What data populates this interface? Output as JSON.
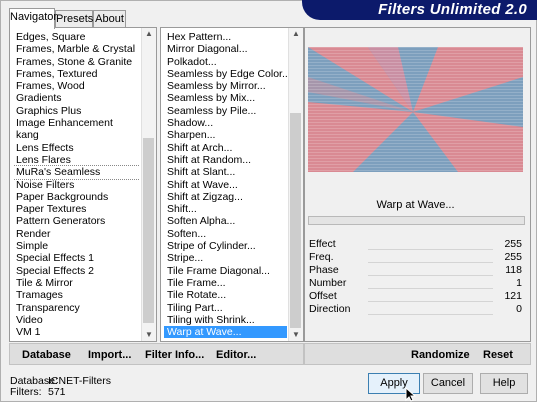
{
  "window": {
    "title": "Filters Unlimited 2.0"
  },
  "tabs": [
    {
      "label": "Navigator"
    },
    {
      "label": "Presets"
    },
    {
      "label": "About"
    }
  ],
  "categories": {
    "items": [
      "Edges, Square",
      "Frames, Marble & Crystal",
      "Frames, Stone & Granite",
      "Frames, Textured",
      "Frames, Wood",
      "Gradients",
      "Graphics Plus",
      "Image Enhancement",
      "kang",
      "Lens Effects",
      "Lens Flares",
      "MuRa's Seamless",
      "Noise Filters",
      "Paper Backgrounds",
      "Paper Textures",
      "Pattern Generators",
      "Render",
      "Simple",
      "Special Effects 1",
      "Special Effects 2",
      "Tile & Mirror",
      "Tramages",
      "Transparency",
      "Video",
      "VM 1"
    ],
    "selected": "MuRa's Seamless"
  },
  "filters": {
    "items": [
      "Hex Pattern...",
      "Mirror Diagonal...",
      "Polkadot...",
      "Seamless by Edge Color...",
      "Seamless by Mirror...",
      "Seamless by Mix...",
      "Seamless by Pile...",
      "Shadow...",
      "Sharpen...",
      "Shift at Arch...",
      "Shift at Random...",
      "Shift at Slant...",
      "Shift at Wave...",
      "Shift at Zigzag...",
      "Shift...",
      "Soften Alpha...",
      "Soften...",
      "Stripe of Cylinder...",
      "Stripe...",
      "Tile Frame Diagonal...",
      "Tile Frame...",
      "Tile Rotate...",
      "Tiling Part...",
      "Tiling with Shrink...",
      "Warp at Wave..."
    ],
    "selected": "Warp at Wave..."
  },
  "preview": {
    "filter_name": "Warp at Wave..."
  },
  "params": [
    {
      "name": "Effect",
      "value": "255"
    },
    {
      "name": "Freq.",
      "value": "255"
    },
    {
      "name": "Phase",
      "value": "118"
    },
    {
      "name": "Number",
      "value": "1"
    },
    {
      "name": "Offset",
      "value": "121"
    },
    {
      "name": "Direction",
      "value": "0"
    }
  ],
  "toolbar": {
    "database": "Database",
    "import": "Import...",
    "filter_info": "Filter Info...",
    "editor": "Editor...",
    "randomize": "Randomize",
    "reset": "Reset"
  },
  "status": {
    "database_label": "Database:",
    "database_value": "ICNET-Filters",
    "filters_label": "Filters:",
    "filters_value": "571"
  },
  "buttons": {
    "apply": "Apply",
    "cancel": "Cancel",
    "help": "Help"
  },
  "colors": {
    "banner": "#0c1a6b",
    "selection": "#3399ff",
    "preview_pink": "#d98a93",
    "preview_blue": "#7d9fbd"
  }
}
